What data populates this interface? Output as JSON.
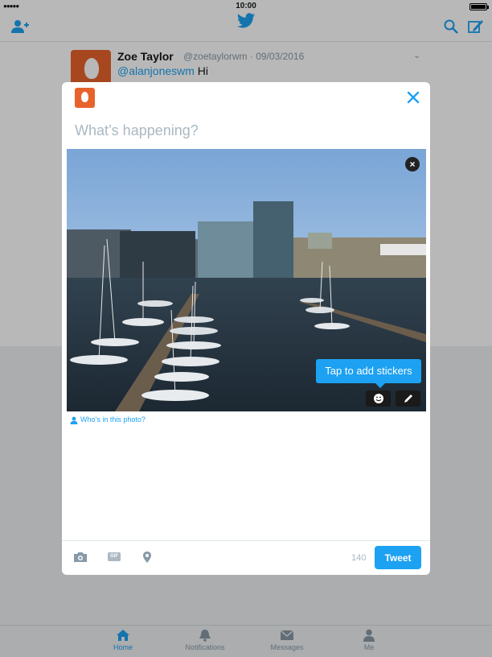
{
  "status_bar": {
    "time": "10:00",
    "signal": "●●●●●"
  },
  "top_nav": {
    "left_icon": "add-user-icon",
    "center_icon": "twitter-bird-icon",
    "right_icons": [
      "search-icon",
      "compose-icon"
    ],
    "accent_color": "#1da1f2"
  },
  "timeline": {
    "tweet": {
      "name": "Zoe Taylor",
      "handle_date": "@zoetaylorwm · 09/03/2016",
      "mention": "@alanjoneswm",
      "text": " Hi"
    }
  },
  "compose": {
    "placeholder": "What’s happening?",
    "sticker_tooltip": "Tap to add stickers",
    "who_in_photo": "Who’s in this photo?",
    "gif_label": "GIF",
    "char_count": "140",
    "tweet_button": "Tweet",
    "photo_icons": [
      "sticker-icon",
      "edit-pencil-icon"
    ],
    "toolbar_icons": [
      "camera-icon",
      "gif-icon",
      "location-pin-icon"
    ]
  },
  "tab_bar": {
    "tabs": [
      {
        "label": "Home",
        "icon": "home-icon",
        "active": true
      },
      {
        "label": "Notifications",
        "icon": "bell-icon",
        "active": false
      },
      {
        "label": "Messages",
        "icon": "envelope-icon",
        "active": false
      },
      {
        "label": "Me",
        "icon": "person-icon",
        "active": false
      }
    ]
  }
}
